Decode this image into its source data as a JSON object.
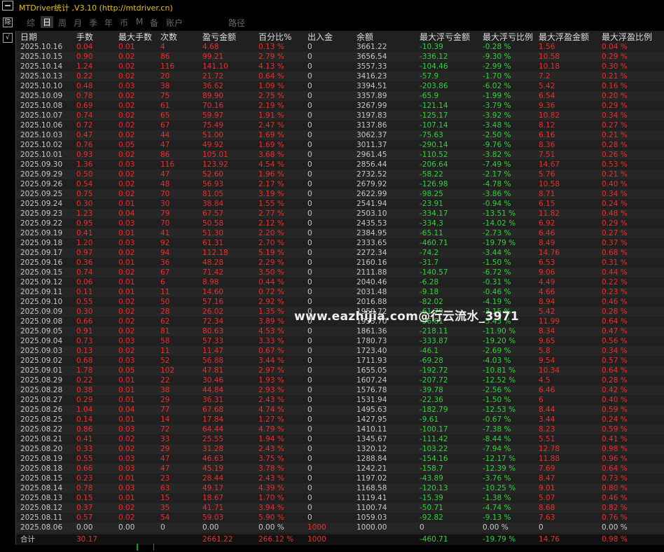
{
  "window": {
    "title": "MTDriver统计 ,V3.10 (http://mtdriver.cn)"
  },
  "leftbar": {
    "btn1": "隐",
    "btn2": "√"
  },
  "tabs": [
    "综",
    "日",
    "周",
    "月",
    "季",
    "年",
    "币",
    "M",
    "备",
    "账户",
    "路径"
  ],
  "table": {
    "headers": [
      "日期",
      "手数",
      "最大手数",
      "次数",
      "盈亏金额",
      "百分比%",
      "出入金",
      "余额",
      "最大浮亏金额",
      "最大浮亏比例",
      "最大浮盈金额",
      "最大浮盈比例"
    ],
    "rows": [
      [
        "2025.10.16",
        "0.04",
        "0.01",
        "4",
        "4.68",
        "0.13 %",
        "0",
        "3661.22",
        "-10.39",
        "-0.28 %",
        "1.56",
        "0.04 %"
      ],
      [
        "2025.10.15",
        "0.90",
        "0.02",
        "86",
        "99.21",
        "2.79 %",
        "0",
        "3656.54",
        "-336.12",
        "-9.30 %",
        "10.58",
        "0.29 %"
      ],
      [
        "2025.10.14",
        "1.24",
        "0.02",
        "116",
        "141.10",
        "4.13 %",
        "0",
        "3557.33",
        "-104.46",
        "-2.99 %",
        "10.18",
        "0.30 %"
      ],
      [
        "2025.10.13",
        "0.22",
        "0.02",
        "20",
        "21.72",
        "0.64 %",
        "0",
        "3416.23",
        "-57.9",
        "-1.70 %",
        "7.2",
        "0.21 %"
      ],
      [
        "2025.10.10",
        "0.48",
        "0.03",
        "38",
        "36.62",
        "1.09 %",
        "0",
        "3394.51",
        "-203.86",
        "-6.02 %",
        "5.42",
        "0.16 %"
      ],
      [
        "2025.10.09",
        "0.78",
        "0.02",
        "75",
        "89.90",
        "2.75 %",
        "0",
        "3357.89",
        "-65.9",
        "-1.99 %",
        "6.54",
        "0.20 %"
      ],
      [
        "2025.10.08",
        "0.69",
        "0.02",
        "61",
        "70.16",
        "2.19 %",
        "0",
        "3267.99",
        "-121.14",
        "-3.79 %",
        "9.36",
        "0.29 %"
      ],
      [
        "2025.10.07",
        "0.74",
        "0.02",
        "65",
        "59.97",
        "1.91 %",
        "0",
        "3197.83",
        "-125.17",
        "-3.92 %",
        "10.82",
        "0.34 %"
      ],
      [
        "2025.10.06",
        "0.72",
        "0.02",
        "67",
        "75.49",
        "2.47 %",
        "0",
        "3137.86",
        "-107.14",
        "-3.48 %",
        "8.12",
        "0.27 %"
      ],
      [
        "2025.10.03",
        "0.47",
        "0.02",
        "44",
        "51.00",
        "1.69 %",
        "0",
        "3062.37",
        "-75.63",
        "-2.50 %",
        "6.16",
        "0.21 %"
      ],
      [
        "2025.10.02",
        "0.76",
        "0.05",
        "47",
        "49.92",
        "1.69 %",
        "0",
        "3011.37",
        "-290.14",
        "-9.76 %",
        "8.36",
        "0.28 %"
      ],
      [
        "2025.10.01",
        "0.93",
        "0.02",
        "86",
        "105.01",
        "3.68 %",
        "0",
        "2961.45",
        "-110.52",
        "-3.82 %",
        "7.51",
        "0.26 %"
      ],
      [
        "2025.09.30",
        "1.36",
        "0.03",
        "116",
        "123.92",
        "4.54 %",
        "0",
        "2856.44",
        "-206.64",
        "-7.49 %",
        "14.67",
        "0.53 %"
      ],
      [
        "2025.09.29",
        "0.50",
        "0.02",
        "47",
        "52.60",
        "1.96 %",
        "0",
        "2732.52",
        "-58.22",
        "-2.17 %",
        "5.76",
        "0.21 %"
      ],
      [
        "2025.09.26",
        "0.54",
        "0.02",
        "48",
        "56.93",
        "2.17 %",
        "0",
        "2679.92",
        "-126.98",
        "-4.78 %",
        "10.58",
        "0.40 %"
      ],
      [
        "2025.09.25",
        "0.75",
        "0.02",
        "70",
        "81.05",
        "3.19 %",
        "0",
        "2622.99",
        "-98.25",
        "-3.86 %",
        "8.71",
        "0.34 %"
      ],
      [
        "2025.09.24",
        "0.30",
        "0.01",
        "30",
        "38.84",
        "1.55 %",
        "0",
        "2541.94",
        "-23.91",
        "-0.94 %",
        "6.15",
        "0.24 %"
      ],
      [
        "2025.09.23",
        "1.23",
        "0.04",
        "79",
        "67.57",
        "2.77 %",
        "0",
        "2503.10",
        "-334.17",
        "-13.51 %",
        "11.82",
        "0.48 %"
      ],
      [
        "2025.09.22",
        "0.95",
        "0.03",
        "70",
        "50.58",
        "2.12 %",
        "0",
        "2435.53",
        "-334.3",
        "-14.02 %",
        "6.92",
        "0.29 %"
      ],
      [
        "2025.09.19",
        "0.41",
        "0.01",
        "41",
        "51.30",
        "2.20 %",
        "0",
        "2384.95",
        "-65.11",
        "-2.73 %",
        "6.46",
        "0.27 %"
      ],
      [
        "2025.09.18",
        "1.20",
        "0.03",
        "92",
        "61.31",
        "2.70 %",
        "0",
        "2333.65",
        "-460.71",
        "-19.79 %",
        "8.49",
        "0.37 %"
      ],
      [
        "2025.09.17",
        "0.97",
        "0.02",
        "94",
        "112.18",
        "5.19 %",
        "0",
        "2272.34",
        "-74.2",
        "-3.44 %",
        "14.76",
        "0.68 %"
      ],
      [
        "2025.09.16",
        "0.36",
        "0.01",
        "36",
        "48.28",
        "2.29 %",
        "0",
        "2160.16",
        "-31.7",
        "-1.50 %",
        "6.53",
        "0.31 %"
      ],
      [
        "2025.09.15",
        "0.74",
        "0.02",
        "67",
        "71.42",
        "3.50 %",
        "0",
        "2111.88",
        "-140.57",
        "-6.72 %",
        "9.06",
        "0.44 %"
      ],
      [
        "2025.09.12",
        "0.06",
        "0.01",
        "6",
        "8.98",
        "0.44 %",
        "0",
        "2040.46",
        "-6.28",
        "-0.31 %",
        "4.49",
        "0.22 %"
      ],
      [
        "2025.09.11",
        "0.11",
        "0.01",
        "11",
        "14.60",
        "0.72 %",
        "0",
        "2031.48",
        "-9.18",
        "-0.46 %",
        "4.66",
        "0.23 %"
      ],
      [
        "2025.09.10",
        "0.55",
        "0.02",
        "50",
        "57.16",
        "2.92 %",
        "0",
        "2016.88",
        "-82.02",
        "-4.19 %",
        "8.94",
        "0.46 %"
      ],
      [
        "2025.09.09",
        "0.30",
        "0.02",
        "28",
        "26.02",
        "1.35 %",
        "0",
        "1959.72",
        "-61.79",
        "-3.15 %",
        "5.42",
        "0.28 %"
      ],
      [
        "2025.09.08",
        "0.66",
        "0.02",
        "62",
        "72.34",
        "3.89 %",
        "0",
        "1933.70",
        "-96.81",
        "-5.43 %",
        "11.99",
        "0.64 %"
      ],
      [
        "2025.09.05",
        "0.91",
        "0.02",
        "81",
        "80.63",
        "4.53 %",
        "0",
        "1861.36",
        "-218.11",
        "-11.90 %",
        "8.34",
        "0.47 %"
      ],
      [
        "2025.09.04",
        "0.73",
        "0.03",
        "58",
        "57.33",
        "3.33 %",
        "0",
        "1780.73",
        "-333.87",
        "-19.20 %",
        "9.65",
        "0.56 %"
      ],
      [
        "2025.09.03",
        "0.13",
        "0.02",
        "11",
        "11.47",
        "0.67 %",
        "0",
        "1723.40",
        "-46.1",
        "-2.69 %",
        "5.8",
        "0.34 %"
      ],
      [
        "2025.09.02",
        "0.68",
        "0.03",
        "52",
        "56.88",
        "3.44 %",
        "0",
        "1711.93",
        "-69.28",
        "-4.03 %",
        "9.54",
        "0.57 %"
      ],
      [
        "2025.09.01",
        "1.78",
        "0.05",
        "102",
        "47.81",
        "2.97 %",
        "0",
        "1655.05",
        "-192.72",
        "-10.81 %",
        "10.34",
        "0.64 %"
      ],
      [
        "2025.08.29",
        "0.22",
        "0.01",
        "22",
        "30.46",
        "1.93 %",
        "0",
        "1607.24",
        "-207.72",
        "-12.52 %",
        "4.5",
        "0.28 %"
      ],
      [
        "2025.08.28",
        "0.38",
        "0.01",
        "38",
        "44.84",
        "2.93 %",
        "0",
        "1576.78",
        "-39.78",
        "-2.56 %",
        "6.46",
        "0.42 %"
      ],
      [
        "2025.08.27",
        "0.29",
        "0.01",
        "29",
        "36.31",
        "2.43 %",
        "0",
        "1531.94",
        "-22.36",
        "-1.50 %",
        "6",
        "0.40 %"
      ],
      [
        "2025.08.26",
        "1.04",
        "0.04",
        "77",
        "67.68",
        "4.74 %",
        "0",
        "1495.63",
        "-182.79",
        "-12.53 %",
        "8.44",
        "0.59 %"
      ],
      [
        "2025.08.25",
        "0.14",
        "0.01",
        "14",
        "17.84",
        "1.27 %",
        "0",
        "1427.95",
        "-9.61",
        "-0.67 %",
        "3.44",
        "0.24 %"
      ],
      [
        "2025.08.22",
        "0.86",
        "0.03",
        "72",
        "64.44",
        "4.79 %",
        "0",
        "1410.11",
        "-100.17",
        "-7.38 %",
        "8.23",
        "0.59 %"
      ],
      [
        "2025.08.21",
        "0.41",
        "0.02",
        "33",
        "25.55",
        "1.94 %",
        "0",
        "1345.67",
        "-111.42",
        "-8.44 %",
        "5.51",
        "0.41 %"
      ],
      [
        "2025.08.20",
        "0.33",
        "0.02",
        "29",
        "31.28",
        "2.43 %",
        "0",
        "1320.12",
        "-103.22",
        "-7.94 %",
        "12.78",
        "0.98 %"
      ],
      [
        "2025.08.19",
        "0.55",
        "0.03",
        "47",
        "46.63",
        "3.75 %",
        "0",
        "1288.84",
        "-154.16",
        "-12.17 %",
        "11.88",
        "0.96 %"
      ],
      [
        "2025.08.18",
        "0.66",
        "0.03",
        "47",
        "45.19",
        "3.78 %",
        "0",
        "1242.21",
        "-158.7",
        "-12.39 %",
        "7.69",
        "0.64 %"
      ],
      [
        "2025.08.15",
        "0.23",
        "0.01",
        "23",
        "28.44",
        "2.43 %",
        "0",
        "1197.02",
        "-43.89",
        "-3.76 %",
        "8.47",
        "0.73 %"
      ],
      [
        "2025.08.14",
        "0.78",
        "0.03",
        "63",
        "49.17",
        "4.39 %",
        "0",
        "1168.58",
        "-120.13",
        "-10.25 %",
        "9.01",
        "0.80 %"
      ],
      [
        "2025.08.13",
        "0.15",
        "0.01",
        "15",
        "18.67",
        "1.70 %",
        "0",
        "1119.41",
        "-15.39",
        "-1.38 %",
        "5.07",
        "0.46 %"
      ],
      [
        "2025.08.12",
        "0.37",
        "0.02",
        "35",
        "41.71",
        "3.94 %",
        "0",
        "1100.74",
        "-50.71",
        "-4.74 %",
        "8.68",
        "0.82 %"
      ],
      [
        "2025.08.11",
        "0.57",
        "0.02",
        "54",
        "59.03",
        "5.90 %",
        "0",
        "1059.03",
        "-92.82",
        "-9.13 %",
        "7.63",
        "0.76 %"
      ],
      [
        "2025.08.06",
        "0.00",
        "0.00",
        "0",
        "0.00",
        "0.00 %",
        "1000",
        "1000.00",
        "0",
        "0.00 %",
        "0",
        "0.00 %"
      ]
    ],
    "total": [
      "合计",
      "30.17",
      "",
      "",
      "2661.22",
      "266.12 %",
      "1000",
      "",
      "-460.71",
      "-19.79 %",
      "14.76",
      "0.98 %"
    ]
  },
  "watermark": "www.eazhijia.com@行云流水_3971",
  "colors": {
    "positive": "#e8302e",
    "negative": "#33d13b",
    "neutral": "#c8c8c8",
    "title": "#e8c200"
  }
}
